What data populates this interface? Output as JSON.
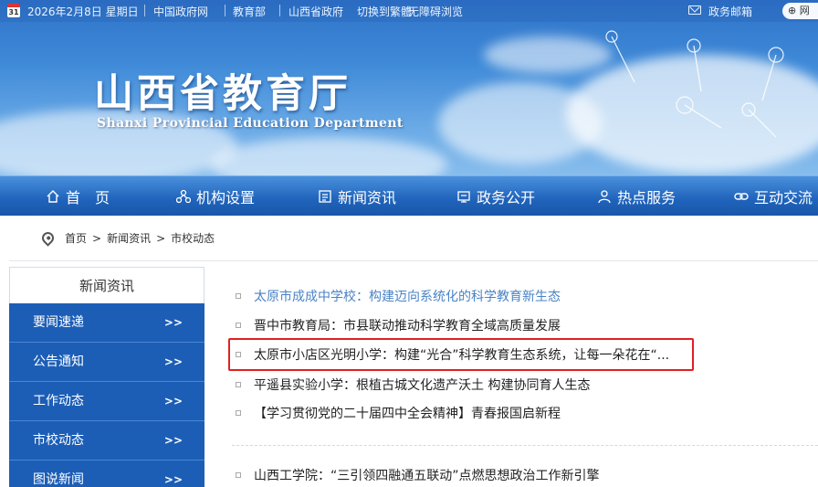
{
  "topbar": {
    "calendar_day": "31",
    "date": "2026年2月8日 星期日",
    "links": [
      "中国政府网",
      "教育部",
      "山西省政府"
    ],
    "switch_text": "切换到繁體",
    "accessible": "无障碍浏览",
    "mail": "政务邮箱",
    "button_label": "网"
  },
  "header": {
    "title_cn": "山西省教育厅",
    "title_en": "Shanxi Provincial Education Department"
  },
  "nav": {
    "items": [
      {
        "label": "首　页",
        "icon": "home-icon"
      },
      {
        "label": "机构设置",
        "icon": "org-icon"
      },
      {
        "label": "新闻资讯",
        "icon": "news-icon"
      },
      {
        "label": "政务公开",
        "icon": "gov-icon"
      },
      {
        "label": "热点服务",
        "icon": "service-icon"
      },
      {
        "label": "互动交流",
        "icon": "link-icon"
      }
    ]
  },
  "breadcrumb": {
    "items": [
      "首页",
      ">",
      "新闻资讯",
      ">",
      "市校动态"
    ]
  },
  "sidebar": {
    "title": "新闻资讯",
    "items": [
      {
        "label": "要闻速递",
        "arrow": ">>"
      },
      {
        "label": "公告通知",
        "arrow": ">>"
      },
      {
        "label": "工作动态",
        "arrow": ">>"
      },
      {
        "label": "市校动态",
        "arrow": ">>"
      },
      {
        "label": "图说新闻",
        "arrow": ">>"
      }
    ]
  },
  "news": {
    "items": [
      {
        "title": "太原市成成中学校：构建迈向系统化的科学教育新生态",
        "state": "visited"
      },
      {
        "title": "晋中市教育局：市县联动推动科学教育全域高质量发展",
        "state": "normal"
      },
      {
        "title": "太原市小店区光明小学：构建“光合”科学教育生态系统，让每一朵花在“...",
        "state": "highlighted"
      },
      {
        "title": "平遥县实验小学：根植古城文化遗产沃土 构建协同育人生态",
        "state": "normal"
      },
      {
        "title": "【学习贯彻党的二十届四中全会精神】青春报国启新程",
        "state": "normal"
      },
      {
        "title": "山西工学院：“三引领四融通五联动”点燃思想政治工作新引擎",
        "state": "normal"
      }
    ],
    "highlight_color": "#e02020"
  },
  "colors": {
    "nav_blue": "#1f63bb",
    "sidebar_blue": "#1c5eb6",
    "visited_link": "#4a83c6"
  }
}
